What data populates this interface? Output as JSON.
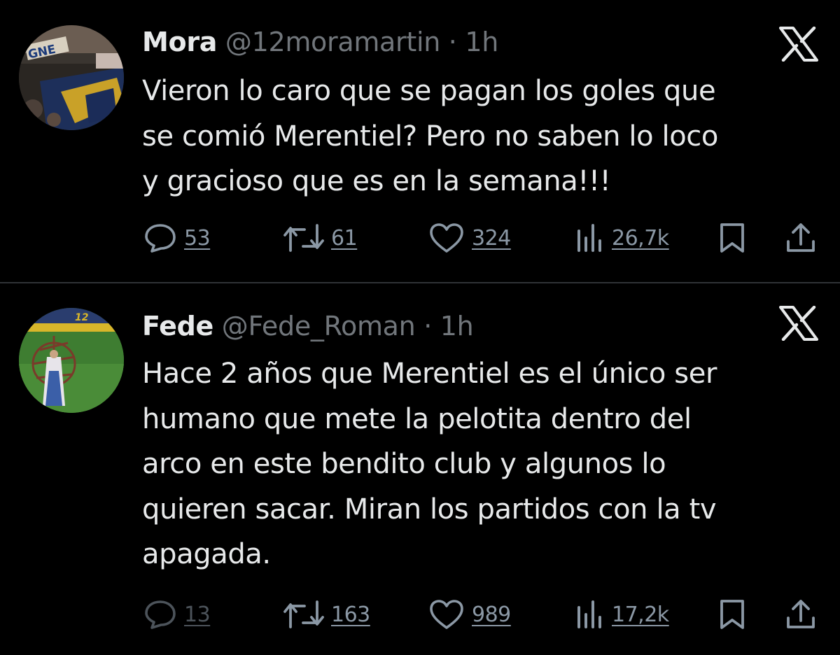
{
  "tweets": [
    {
      "name": "Mora",
      "handle": "@12moramartin",
      "separator": "·",
      "time": "1h",
      "text_lines": [
        "Vieron lo caro que se pagan los goles que",
        "se comió Merentiel? Pero no saben lo loco",
        "y gracioso que es en la semana!!!"
      ],
      "stats": {
        "replies": "53",
        "reposts": "61",
        "likes": "324",
        "views": "26,7k"
      },
      "avatar_text": "GNE"
    },
    {
      "name": "Fede",
      "handle": "@Fede_Roman",
      "separator": "·",
      "time": "1h",
      "text_lines": [
        "Hace 2 años que Merentiel es el único ser",
        "humano que mete la pelotita dentro del",
        "arco en este bendito club y algunos lo",
        "quieren sacar. Miran los partidos con la tv",
        "apagada."
      ],
      "stats": {
        "replies": "13",
        "reposts": "163",
        "likes": "989",
        "views": "17,2k"
      },
      "avatar_text": "12"
    }
  ],
  "colors": {
    "background": "#000000",
    "text": "#e7e9ea",
    "secondary": "#71767b",
    "icon": "#8b98a5",
    "divider": "#2f3336"
  },
  "icons": {
    "reply": "speech-bubble-icon",
    "repost": "repost-arrows-icon",
    "like": "heart-icon",
    "views": "bar-chart-icon",
    "bookmark": "bookmark-icon",
    "share": "share-upload-icon",
    "brand": "x-logo-icon"
  }
}
